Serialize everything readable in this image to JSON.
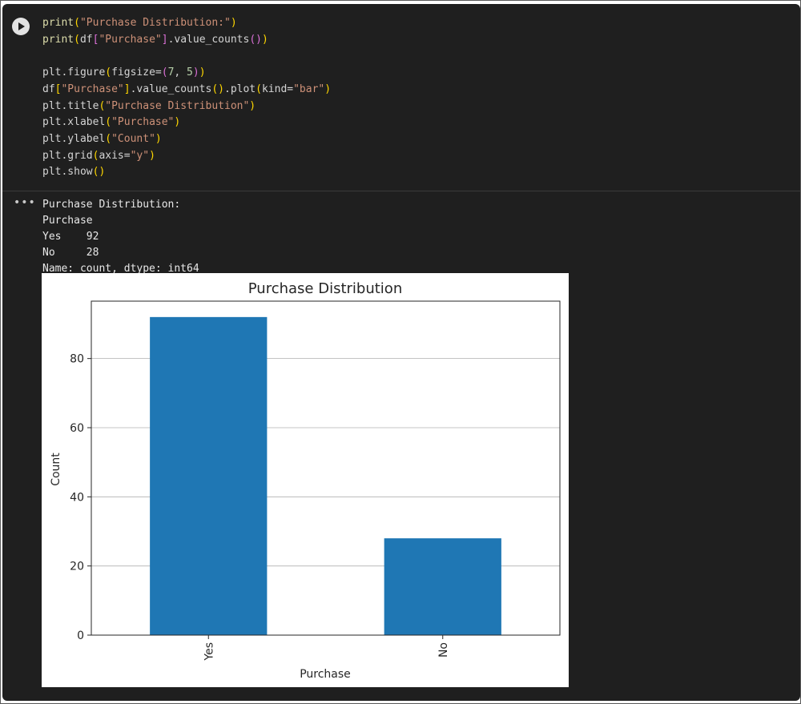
{
  "notebook": {
    "code_lines": [
      [
        [
          "fn",
          "print"
        ],
        [
          "b1",
          "("
        ],
        [
          "str",
          "\"Purchase Distribution:\""
        ],
        [
          "b1",
          ")"
        ]
      ],
      [
        [
          "fn",
          "print"
        ],
        [
          "b1",
          "("
        ],
        [
          "t",
          "df"
        ],
        [
          "b2",
          "["
        ],
        [
          "str",
          "\"Purchase\""
        ],
        [
          "b2",
          "]"
        ],
        [
          "t",
          ".value_counts"
        ],
        [
          "b2",
          "()"
        ],
        [
          "b1",
          ")"
        ]
      ],
      [],
      [
        [
          "t",
          "plt.figure"
        ],
        [
          "b1",
          "("
        ],
        [
          "t",
          "figsize="
        ],
        [
          "b2",
          "("
        ],
        [
          "num",
          "7"
        ],
        [
          "t",
          ", "
        ],
        [
          "num",
          "5"
        ],
        [
          "b2",
          ")"
        ],
        [
          "b1",
          ")"
        ]
      ],
      [
        [
          "t",
          "df"
        ],
        [
          "b1",
          "["
        ],
        [
          "str",
          "\"Purchase\""
        ],
        [
          "b1",
          "]"
        ],
        [
          "t",
          ".value_counts"
        ],
        [
          "b1",
          "()"
        ],
        [
          "t",
          ".plot"
        ],
        [
          "b1",
          "("
        ],
        [
          "t",
          "kind="
        ],
        [
          "str",
          "\"bar\""
        ],
        [
          "b1",
          ")"
        ]
      ],
      [
        [
          "t",
          "plt.title"
        ],
        [
          "b1",
          "("
        ],
        [
          "str",
          "\"Purchase Distribution\""
        ],
        [
          "b1",
          ")"
        ]
      ],
      [
        [
          "t",
          "plt.xlabel"
        ],
        [
          "b1",
          "("
        ],
        [
          "str",
          "\"Purchase\""
        ],
        [
          "b1",
          ")"
        ]
      ],
      [
        [
          "t",
          "plt.ylabel"
        ],
        [
          "b1",
          "("
        ],
        [
          "str",
          "\"Count\""
        ],
        [
          "b1",
          ")"
        ]
      ],
      [
        [
          "t",
          "plt.grid"
        ],
        [
          "b1",
          "("
        ],
        [
          "t",
          "axis="
        ],
        [
          "str",
          "\"y\""
        ],
        [
          "b1",
          ")"
        ]
      ],
      [
        [
          "t",
          "plt.show"
        ],
        [
          "b1",
          "()"
        ]
      ]
    ],
    "stdout_lines": [
      "Purchase Distribution:",
      "Purchase",
      "Yes    92",
      "No     28",
      "Name: count, dtype: int64"
    ]
  },
  "colors": {
    "bar": "#1f77b4",
    "grid": "#b0b0b0"
  },
  "chart_data": {
    "type": "bar",
    "title": "Purchase Distribution",
    "xlabel": "Purchase",
    "ylabel": "Count",
    "categories": [
      "Yes",
      "No"
    ],
    "values": [
      92,
      28
    ],
    "ylim": [
      0,
      96.6
    ],
    "yticks": [
      0,
      20,
      40,
      60,
      80
    ],
    "grid": "y"
  }
}
